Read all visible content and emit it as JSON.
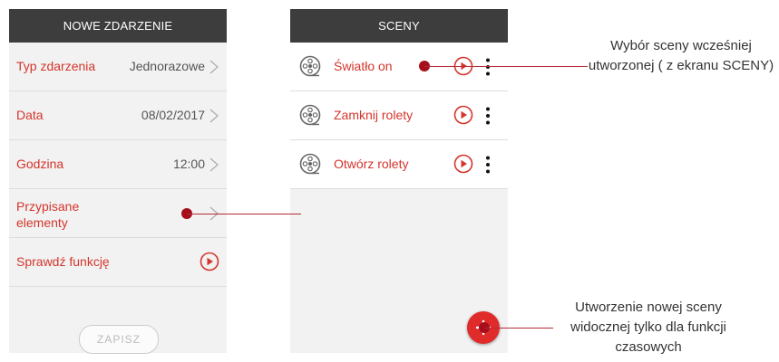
{
  "left_panel": {
    "title": "NOWE ZDARZENIE",
    "rows": [
      {
        "label": "Typ zdarzenia",
        "value": "Jednorazowe"
      },
      {
        "label": "Data",
        "value": "08/02/2017"
      },
      {
        "label": "Godzina",
        "value": "12:00"
      },
      {
        "label": "Przypisane\nelementy",
        "value": ""
      },
      {
        "label": "Sprawdź funkcję",
        "value": ""
      }
    ],
    "save_label": "ZAPISZ"
  },
  "right_panel": {
    "title": "SCENY",
    "scenes": [
      {
        "label": "Światło on"
      },
      {
        "label": "Zamknij rolety"
      },
      {
        "label": "Otwórz rolety"
      }
    ]
  },
  "annotations": {
    "scene_choice": "Wybór sceny wcześniej utworzonej ( z ekranu SCENY)",
    "new_scene": "Utworzenie nowej sceny widocznej tylko dla funkcji czasowych"
  },
  "colors": {
    "accent": "#d4352c",
    "header": "#3d3d3d",
    "fab": "#e02b2b",
    "marker": "#a50e1a"
  }
}
